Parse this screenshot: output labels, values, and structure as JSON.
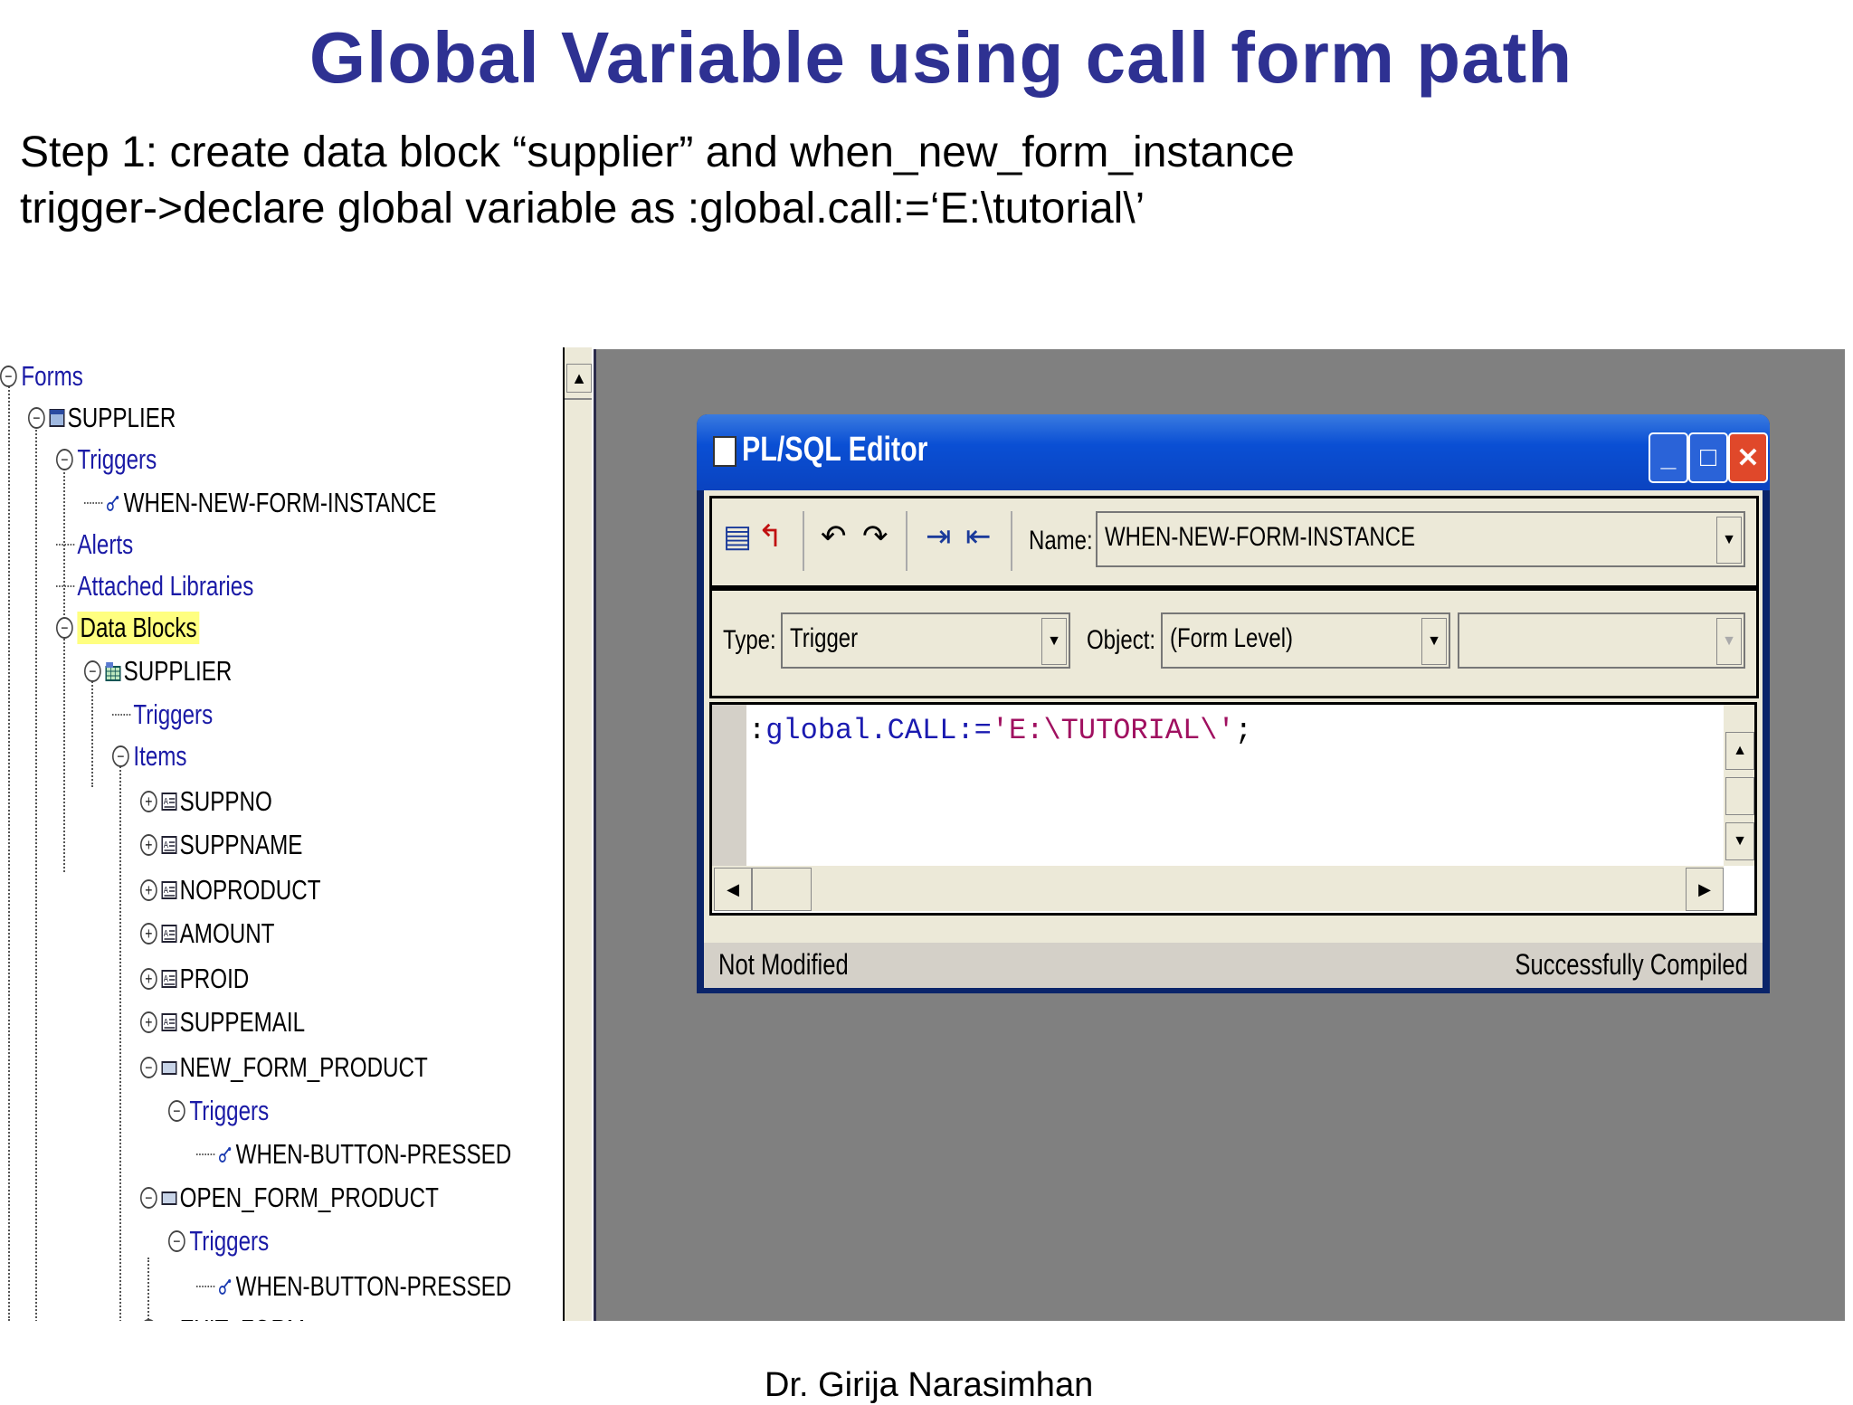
{
  "slide": {
    "title": "Global Variable using call form path",
    "step_line1": "Step 1: create data  block “supplier” and when_new_form_instance",
    "step_line2": "trigger->declare global variable as :global.call:=‘E:\\tutorial\\’",
    "footer": "Dr. Girija Narasimhan"
  },
  "navigator": {
    "items": [
      {
        "label": "Forms",
        "color": "blue",
        "toggle": "−",
        "icon": "none"
      },
      {
        "label": "SUPPLIER",
        "color": "black",
        "toggle": "−",
        "icon": "form-icon"
      },
      {
        "label": "Triggers",
        "color": "blue",
        "toggle": "−",
        "icon": "none"
      },
      {
        "label": "WHEN-NEW-FORM-INSTANCE",
        "color": "black",
        "toggle": "",
        "icon": "trigger-icon"
      },
      {
        "label": "Alerts",
        "color": "blue",
        "toggle": "",
        "icon": "none"
      },
      {
        "label": "Attached Libraries",
        "color": "blue",
        "toggle": "",
        "icon": "none"
      },
      {
        "label": "Data Blocks",
        "color": "black",
        "toggle": "−",
        "icon": "none",
        "highlight": true
      },
      {
        "label": "SUPPLIER",
        "color": "black",
        "toggle": "−",
        "icon": "datablock-icon"
      },
      {
        "label": "Triggers",
        "color": "blue",
        "toggle": "",
        "icon": "none"
      },
      {
        "label": "Items",
        "color": "blue",
        "toggle": "−",
        "icon": "none"
      },
      {
        "label": "SUPPNO",
        "color": "black",
        "toggle": "+",
        "icon": "textitem-icon"
      },
      {
        "label": "SUPPNAME",
        "color": "black",
        "toggle": "+",
        "icon": "textitem-icon"
      },
      {
        "label": "NOPRODUCT",
        "color": "black",
        "toggle": "+",
        "icon": "textitem-icon"
      },
      {
        "label": "AMOUNT",
        "color": "black",
        "toggle": "+",
        "icon": "textitem-icon"
      },
      {
        "label": "PROID",
        "color": "black",
        "toggle": "+",
        "icon": "textitem-icon"
      },
      {
        "label": "SUPPEMAIL",
        "color": "black",
        "toggle": "+",
        "icon": "textitem-icon"
      },
      {
        "label": "NEW_FORM_PRODUCT",
        "color": "black",
        "toggle": "−",
        "icon": "button-icon"
      },
      {
        "label": "Triggers",
        "color": "blue",
        "toggle": "−",
        "icon": "none"
      },
      {
        "label": "WHEN-BUTTON-PRESSED",
        "color": "black",
        "toggle": "",
        "icon": "trigger-icon"
      },
      {
        "label": "OPEN_FORM_PRODUCT",
        "color": "black",
        "toggle": "−",
        "icon": "button-icon"
      },
      {
        "label": "Triggers",
        "color": "blue",
        "toggle": "−",
        "icon": "none"
      },
      {
        "label": "WHEN-BUTTON-PRESSED",
        "color": "black",
        "toggle": "",
        "icon": "trigger-icon"
      },
      {
        "label": "EXIT_FORM",
        "color": "black",
        "toggle": "+",
        "icon": "button-icon"
      }
    ]
  },
  "editor": {
    "title": "PL/SQL Editor",
    "name_label": "Name:",
    "name_value": "WHEN-NEW-FORM-INSTANCE",
    "type_label": "Type:",
    "type_value": "Trigger",
    "object_label": "Object:",
    "object_value": "(Form Level)",
    "object2_value": "",
    "code": {
      "prefix": ":",
      "kw1": "global",
      "dot": ".",
      "kw2": "CALL",
      "assign": ":=",
      "str": "'E:\\TUTORIAL\\'",
      "end": ";"
    },
    "status_left": "Not Modified",
    "status_right": "Successfully Compiled"
  },
  "colors": {
    "title": "#2e3192",
    "canvas": "#808080",
    "titlebar": "#0a4fd4"
  }
}
